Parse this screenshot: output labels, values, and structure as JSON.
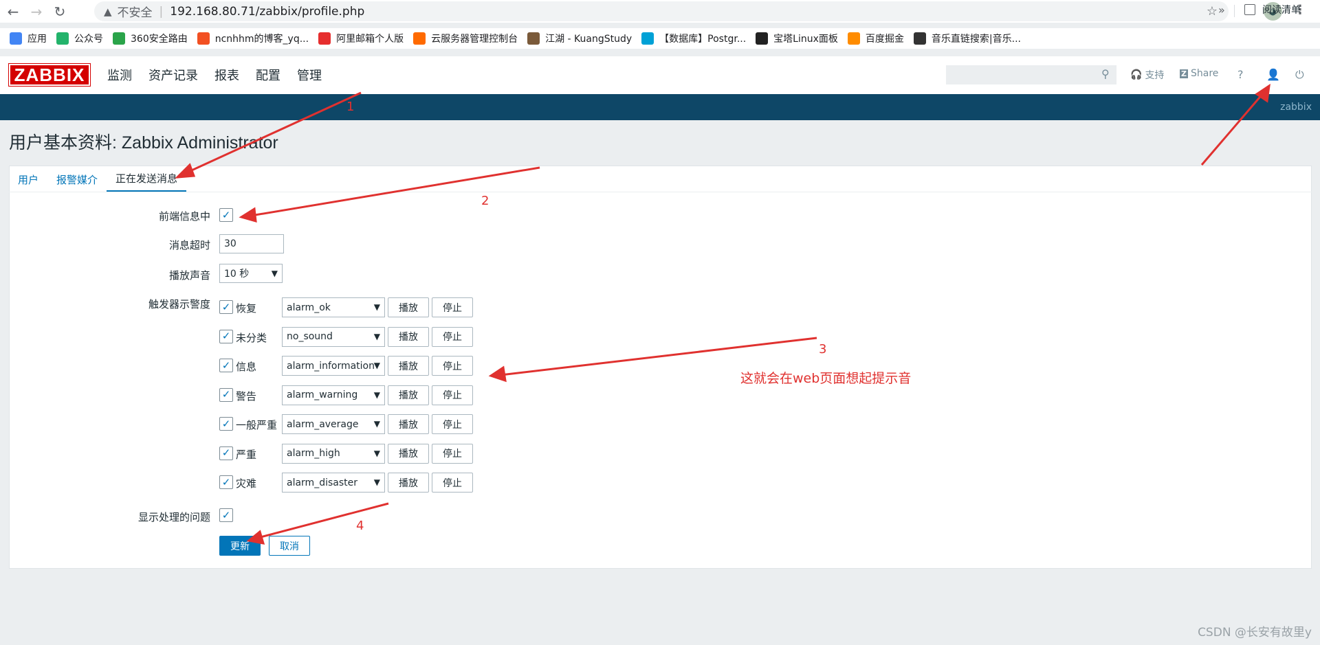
{
  "browser": {
    "insecure_label": "不安全",
    "url": "192.168.80.71/zabbix/profile.php",
    "bookmarks": [
      {
        "label": "应用",
        "color": "#4285f4"
      },
      {
        "label": "公众号",
        "color": "#23b36b"
      },
      {
        "label": "360安全路由",
        "color": "#2aa44a"
      },
      {
        "label": "ncnhhm的博客_yq...",
        "color": "#f25022"
      },
      {
        "label": "阿里邮箱个人版",
        "color": "#e62e2e"
      },
      {
        "label": "云服务器管理控制台",
        "color": "#ff6a00"
      },
      {
        "label": "江湖 - KuangStudy",
        "color": "#7a5a3a"
      },
      {
        "label": "【数据库】Postgr...",
        "color": "#00a1d6"
      },
      {
        "label": "宝塔Linux面板",
        "color": "#222222"
      },
      {
        "label": "百度掘金",
        "color": "#ff8c00"
      },
      {
        "label": "音乐直链搜索|音乐...",
        "color": "#333333"
      }
    ],
    "bookmark_more": "»",
    "reading_list": "阅读清单"
  },
  "header": {
    "logo": "ZABBIX",
    "menu": [
      "监测",
      "资产记录",
      "报表",
      "配置",
      "管理"
    ],
    "support": "支持",
    "share": "Share",
    "help": "?",
    "strip_user": "zabbix"
  },
  "page": {
    "title": "用户基本资料: Zabbix Administrator",
    "tabs": [
      "用户",
      "报警媒介",
      "正在发送消息"
    ],
    "active_tab": 2
  },
  "form": {
    "frontend_messaging_label": "前端信息中",
    "frontend_messaging_checked": true,
    "timeout_label": "消息超时",
    "timeout_value": "30",
    "play_sound_label": "播放声音",
    "play_sound_value": "10 秒",
    "trigger_severity_label": "触发器示警度",
    "severities": [
      {
        "name": "恢复",
        "sound": "alarm_ok",
        "checked": true
      },
      {
        "name": "未分类",
        "sound": "no_sound",
        "checked": true
      },
      {
        "name": "信息",
        "sound": "alarm_information",
        "checked": true
      },
      {
        "name": "警告",
        "sound": "alarm_warning",
        "checked": true
      },
      {
        "name": "一般严重",
        "sound": "alarm_average",
        "checked": true
      },
      {
        "name": "严重",
        "sound": "alarm_high",
        "checked": true
      },
      {
        "name": "灾难",
        "sound": "alarm_disaster",
        "checked": true
      }
    ],
    "play_label": "播放",
    "stop_label": "停止",
    "show_suppressed_label": "显示处理的问题",
    "show_suppressed_checked": true,
    "update_label": "更新",
    "cancel_label": "取消"
  },
  "annotations": {
    "n1": "1",
    "n2": "2",
    "n3": "3",
    "n4": "4",
    "note3": "这就会在web页面想起提示音",
    "color": "#e0312f"
  },
  "watermark": "CSDN @长安有故里y"
}
